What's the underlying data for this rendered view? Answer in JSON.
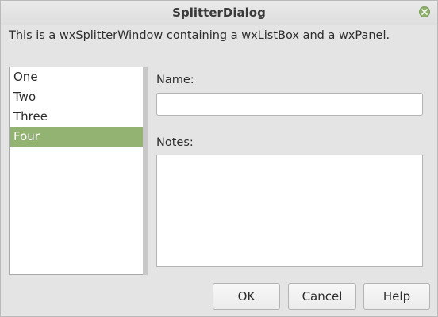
{
  "window": {
    "title": "SplitterDialog"
  },
  "description": "This is a wxSplitterWindow containing a wxListBox and a wxPanel.",
  "listbox": {
    "items": [
      {
        "label": "One",
        "selected": false
      },
      {
        "label": "Two",
        "selected": false
      },
      {
        "label": "Three",
        "selected": false
      },
      {
        "label": "Four",
        "selected": true
      }
    ]
  },
  "form": {
    "name_label": "Name:",
    "name_value": "",
    "notes_label": "Notes:",
    "notes_value": ""
  },
  "buttons": {
    "ok": "OK",
    "cancel": "Cancel",
    "help": "Help"
  },
  "colors": {
    "selection": "#92b372",
    "close_button": "#8fb06c"
  }
}
